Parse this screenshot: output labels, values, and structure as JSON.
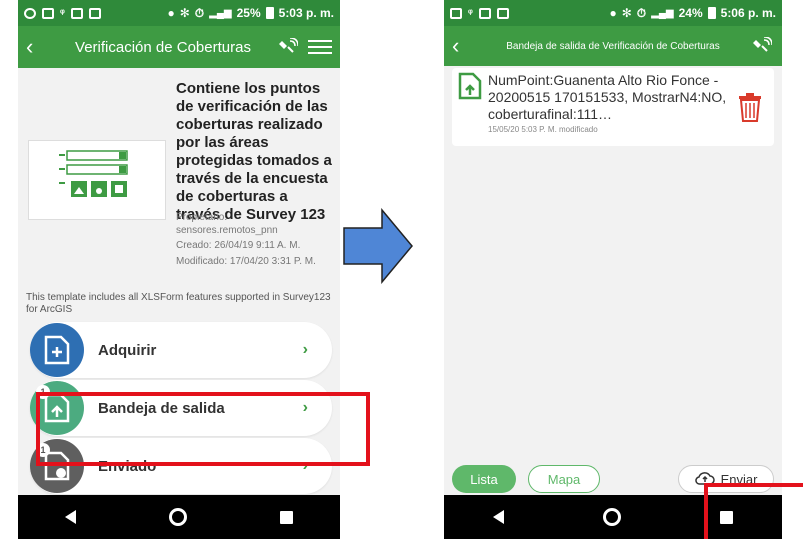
{
  "left": {
    "status": {
      "battery": "25%",
      "time": "5:03 p. m."
    },
    "appbar": {
      "title": "Verificación de Coberturas"
    },
    "item": {
      "description": "Contiene los puntos de verificación de las coberturas realizado por las áreas protegidas tomados a través de la encuesta de coberturas a través de Survey 123",
      "owner_label": "Propietario:",
      "owner": "sensores.remotos_pnn",
      "created": "Creado: 26/04/19 9:11 A. M.",
      "modified": "Modificado: 17/04/20 3:31 P. M."
    },
    "template_note": "This template includes all XLSForm features supported in Survey123 for ArcGIS",
    "menu": [
      {
        "label": "Adquirir",
        "color": "#2e6fb3",
        "badge": ""
      },
      {
        "label": "Bandeja de salida",
        "color": "#4cab80",
        "badge": "1"
      },
      {
        "label": "Enviado",
        "color": "#5f5f5f",
        "badge": "1"
      }
    ]
  },
  "right": {
    "status": {
      "battery": "24%",
      "time": "5:06 p. m."
    },
    "appbar": {
      "title": "Bandeja de salida de Verificación de Coberturas"
    },
    "outbox_item": {
      "text": "NumPoint:Guanenta Alto Rio Fonce - 20200515 170151533, MostrarN4:NO, coberturafinal:111…",
      "modified": "15/05/20 5:03 P. M. modificado"
    },
    "bottom": {
      "list_label": "Lista",
      "map_label": "Mapa",
      "send_label": "Enviar"
    }
  },
  "colors": {
    "app_green": "#3e9b43",
    "status_green": "#2f8a3a",
    "highlight": "#e3111b",
    "arrow": "#4f86d6"
  }
}
